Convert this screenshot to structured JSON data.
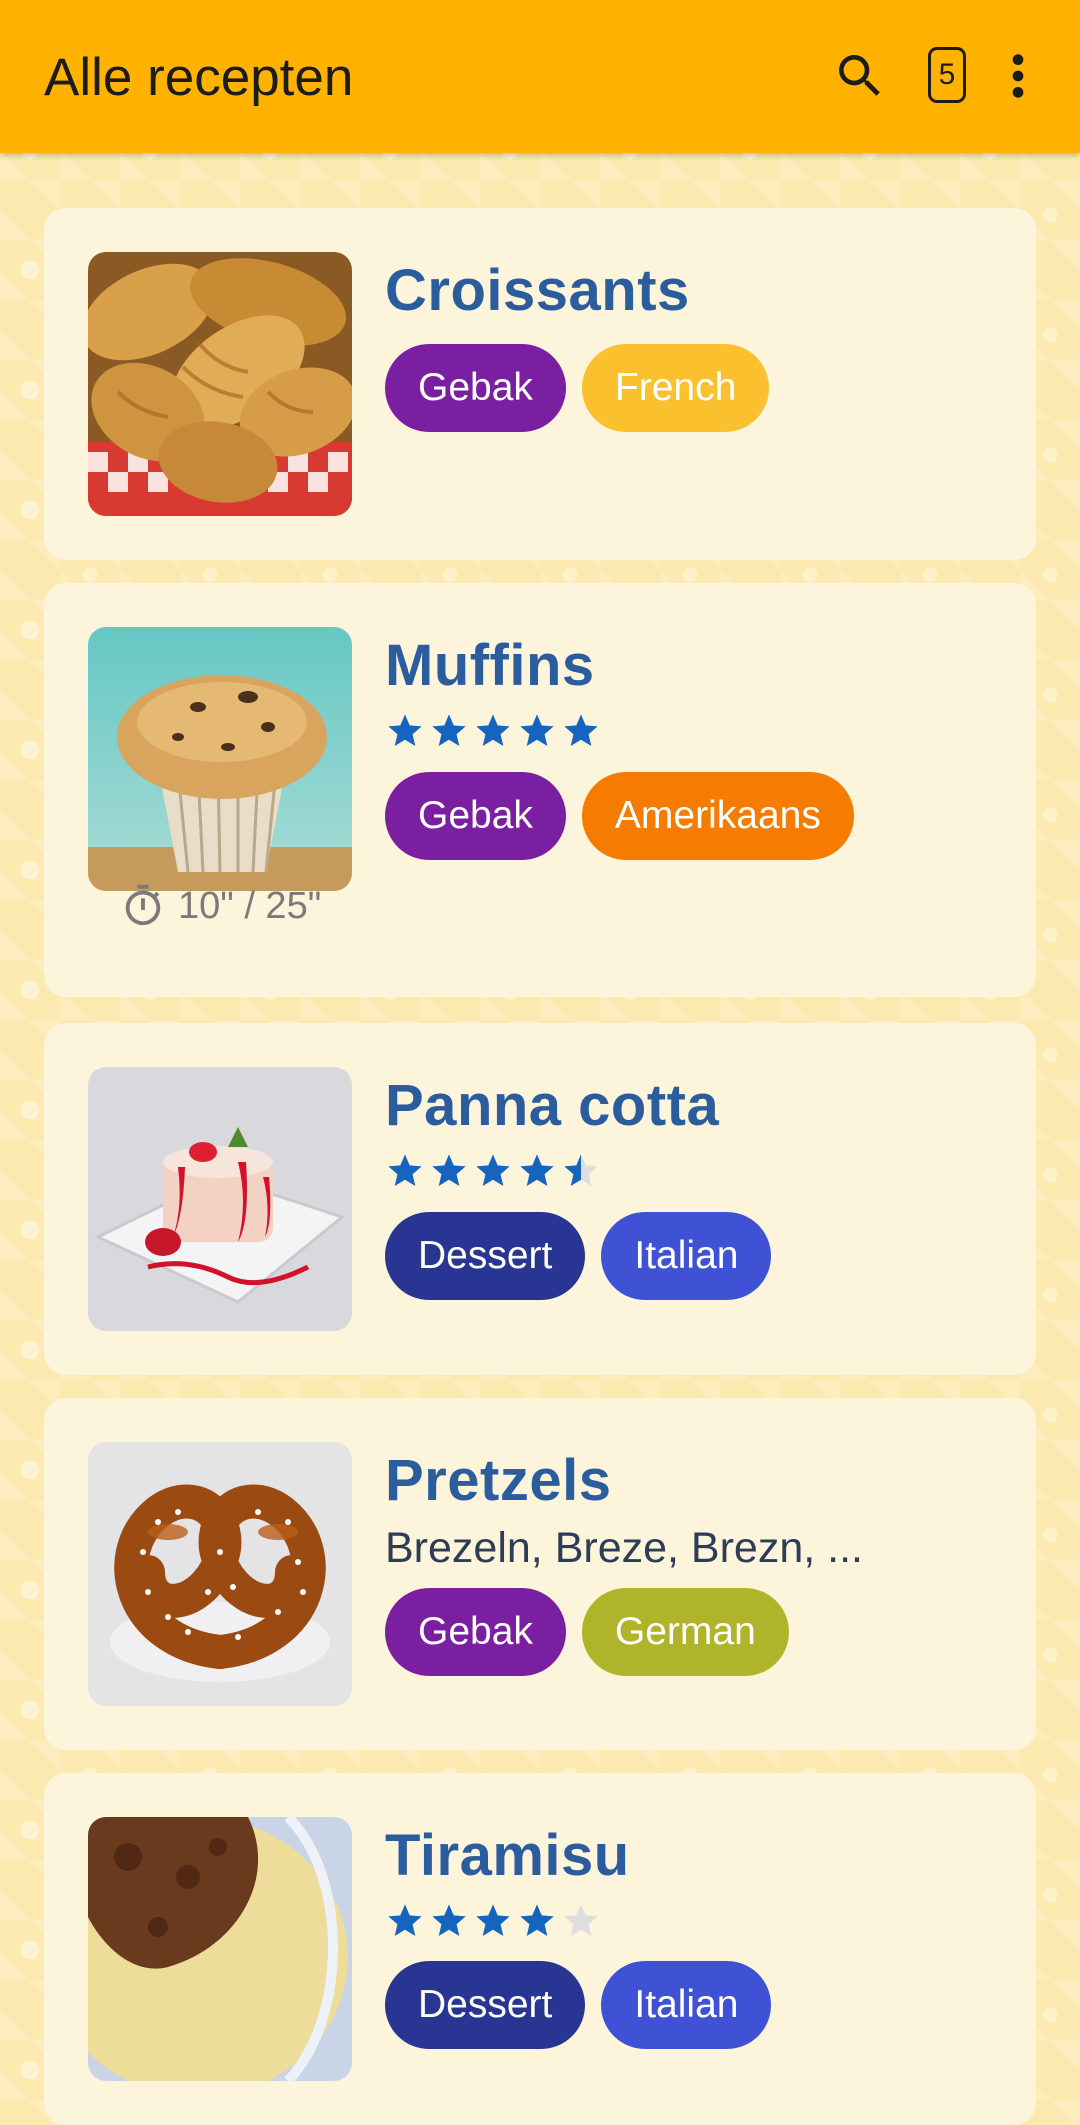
{
  "appbar": {
    "title": "Alle recepten",
    "count": "5",
    "background": "#ffb300",
    "search_icon": "search-icon",
    "menu_icon": "more-vert-icon"
  },
  "recipes": [
    {
      "name": "Croissants",
      "rating": null,
      "aliases": null,
      "time": null,
      "image": "croissants-photo",
      "tags": [
        {
          "label": "Gebak",
          "color": "#7b1fa2"
        },
        {
          "label": "French",
          "color": "#fbc02d"
        }
      ]
    },
    {
      "name": "Muffins",
      "rating": 5,
      "aliases": null,
      "time": "10\" / 25\"",
      "image": "muffin-photo",
      "tags": [
        {
          "label": "Gebak",
          "color": "#7b1fa2"
        },
        {
          "label": "Amerikaans",
          "color": "#f57c00"
        }
      ]
    },
    {
      "name": "Panna cotta",
      "rating": 4.5,
      "aliases": null,
      "time": null,
      "image": "panna-cotta-photo",
      "tags": [
        {
          "label": "Dessert",
          "color": "#283593"
        },
        {
          "label": "Italian",
          "color": "#3f51d5"
        }
      ]
    },
    {
      "name": "Pretzels",
      "rating": null,
      "aliases": "Brezeln, Breze, Brezn, ...",
      "time": null,
      "image": "pretzel-photo",
      "tags": [
        {
          "label": "Gebak",
          "color": "#7b1fa2"
        },
        {
          "label": "German",
          "color": "#afb42b"
        }
      ]
    },
    {
      "name": "Tiramisu",
      "rating": 4,
      "aliases": null,
      "time": null,
      "image": "tiramisu-photo",
      "tags": [
        {
          "label": "Dessert",
          "color": "#283593"
        },
        {
          "label": "Italian",
          "color": "#3f51d5"
        }
      ]
    }
  ],
  "colors": {
    "star_filled": "#1565c0",
    "star_empty": "#dedede",
    "recipe_title": "#2b5c9e"
  }
}
